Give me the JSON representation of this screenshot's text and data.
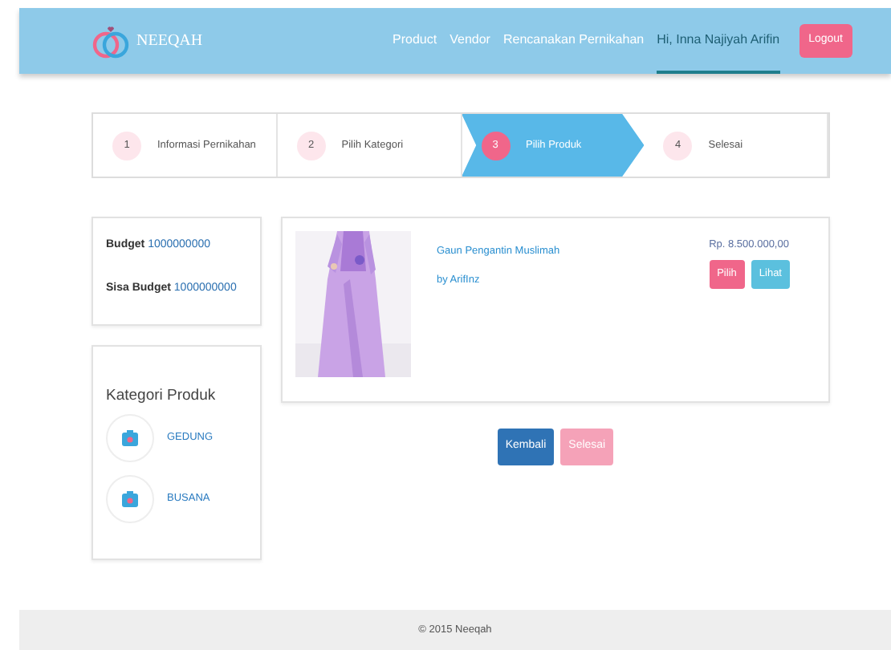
{
  "brand": {
    "name": "NEEQAH"
  },
  "nav": [
    {
      "label": "Product",
      "selected": false
    },
    {
      "label": "Vendor",
      "selected": false
    },
    {
      "label": "Rencanakan Pernikahan",
      "selected": false
    },
    {
      "label": "Hi, Inna Najiyah Arifin",
      "selected": true
    }
  ],
  "logout_button": "Logout",
  "steps": [
    {
      "number": "1",
      "label": "Informasi Pernikahan",
      "selected": false
    },
    {
      "number": "2",
      "label": "Pilih Kategori",
      "selected": false
    },
    {
      "number": "3",
      "label": "Pilih Produk",
      "selected": true
    },
    {
      "number": "4",
      "label": "Selesai",
      "selected": false
    }
  ],
  "budget": [
    {
      "label": "Budget",
      "value": "1000000000"
    },
    {
      "label": "Sisa Budget",
      "value": "1000000000"
    }
  ],
  "categories": {
    "title": "Kategori Produk",
    "items": [
      "GEDUNG",
      "BUSANA"
    ]
  },
  "products": [
    {
      "kind": "picture",
      "name": "Gaun Pengantin Muslimah",
      "vendor": "by ArifInz",
      "price": "Rp. 8.500.000,00",
      "buttons": [
        "Pilih",
        "Lihat"
      ]
    }
  ],
  "actions": [
    {
      "label": "Kembali",
      "disabled": false
    },
    {
      "label": "Selesai",
      "disabled": true
    }
  ],
  "footer": "© 2015 Neeqah"
}
